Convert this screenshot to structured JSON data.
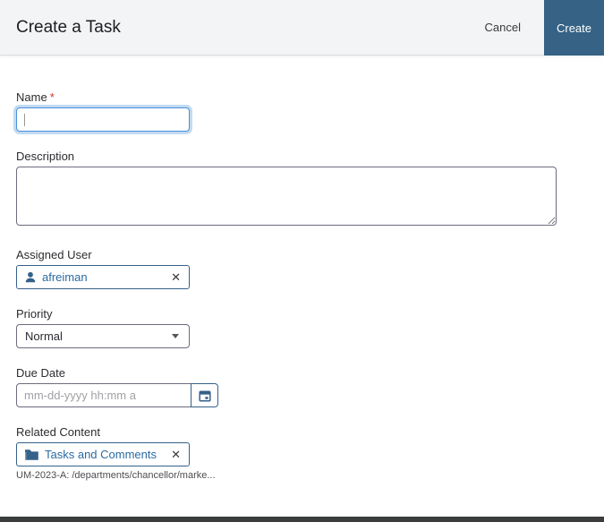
{
  "header": {
    "title": "Create a Task",
    "cancel_label": "Cancel",
    "create_label": "Create"
  },
  "form": {
    "name": {
      "label": "Name",
      "required_marker": "*",
      "value": ""
    },
    "description": {
      "label": "Description",
      "value": ""
    },
    "assigned_user": {
      "label": "Assigned User",
      "selected_user": "afreiman",
      "remove_icon": "✕"
    },
    "priority": {
      "label": "Priority",
      "selected_option": "Normal"
    },
    "due_date": {
      "label": "Due Date",
      "value": "",
      "placeholder": "mm-dd-yyyy hh:mm a"
    },
    "related_content": {
      "label": "Related Content",
      "selected_item": "Tasks and Comments",
      "remove_icon": "✕",
      "helper_text": "UM-2023-A: /departments/chancellor/marke..."
    }
  },
  "colors": {
    "accent_blue": "#356285",
    "link_blue": "#2a6ba3",
    "focus_border": "#4a90d9",
    "required_red": "#d0342c",
    "header_bg": "#f3f4f6",
    "input_border": "#6b6c7e",
    "bottom_bar": "#3b3c3e"
  }
}
